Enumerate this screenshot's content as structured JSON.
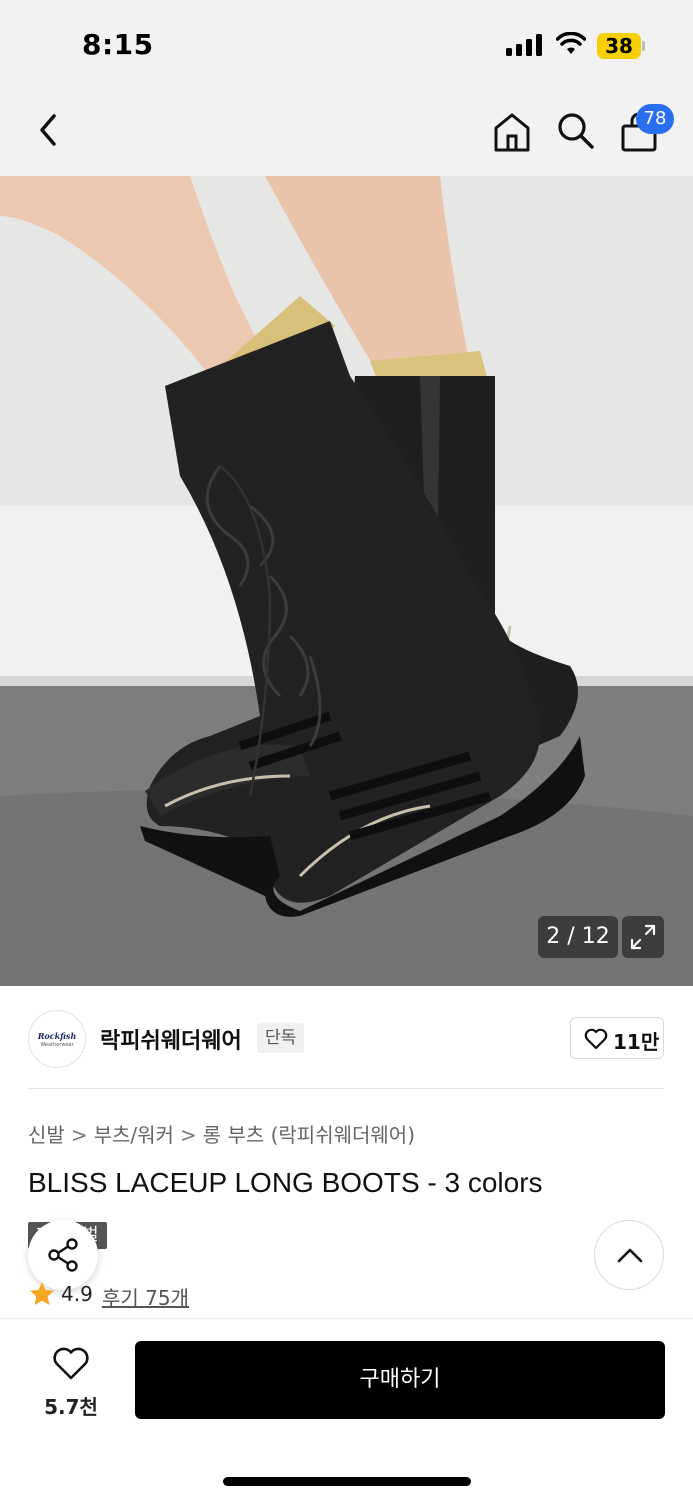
{
  "status_bar": {
    "time": "8:15",
    "battery": "38"
  },
  "nav": {
    "cart_count": "78"
  },
  "gallery": {
    "counter": "2 / 12"
  },
  "brand": {
    "logo_text": "Rockfish",
    "logo_subtext": "Weatherwear",
    "name": "락피쉬웨더웨어",
    "tag": "단독",
    "like_count": "11만"
  },
  "breadcrumb": {
    "items": [
      "신발",
      "부츠/워커",
      "롱 부츠 (락피쉬웨더웨어)"
    ]
  },
  "product": {
    "title": "BLISS LACEUP LONG BOOTS - 3 colors",
    "festival_tag": "페스티벌",
    "rating": "4.9",
    "review_label": "후기 75개"
  },
  "bottom_bar": {
    "wish_count": "5.7천",
    "buy_label": "구매하기"
  },
  "colors": {
    "accent": "#2a6ff1",
    "star": "#f5a623",
    "buy_button": "#000000",
    "battery": "#f5cf00"
  }
}
